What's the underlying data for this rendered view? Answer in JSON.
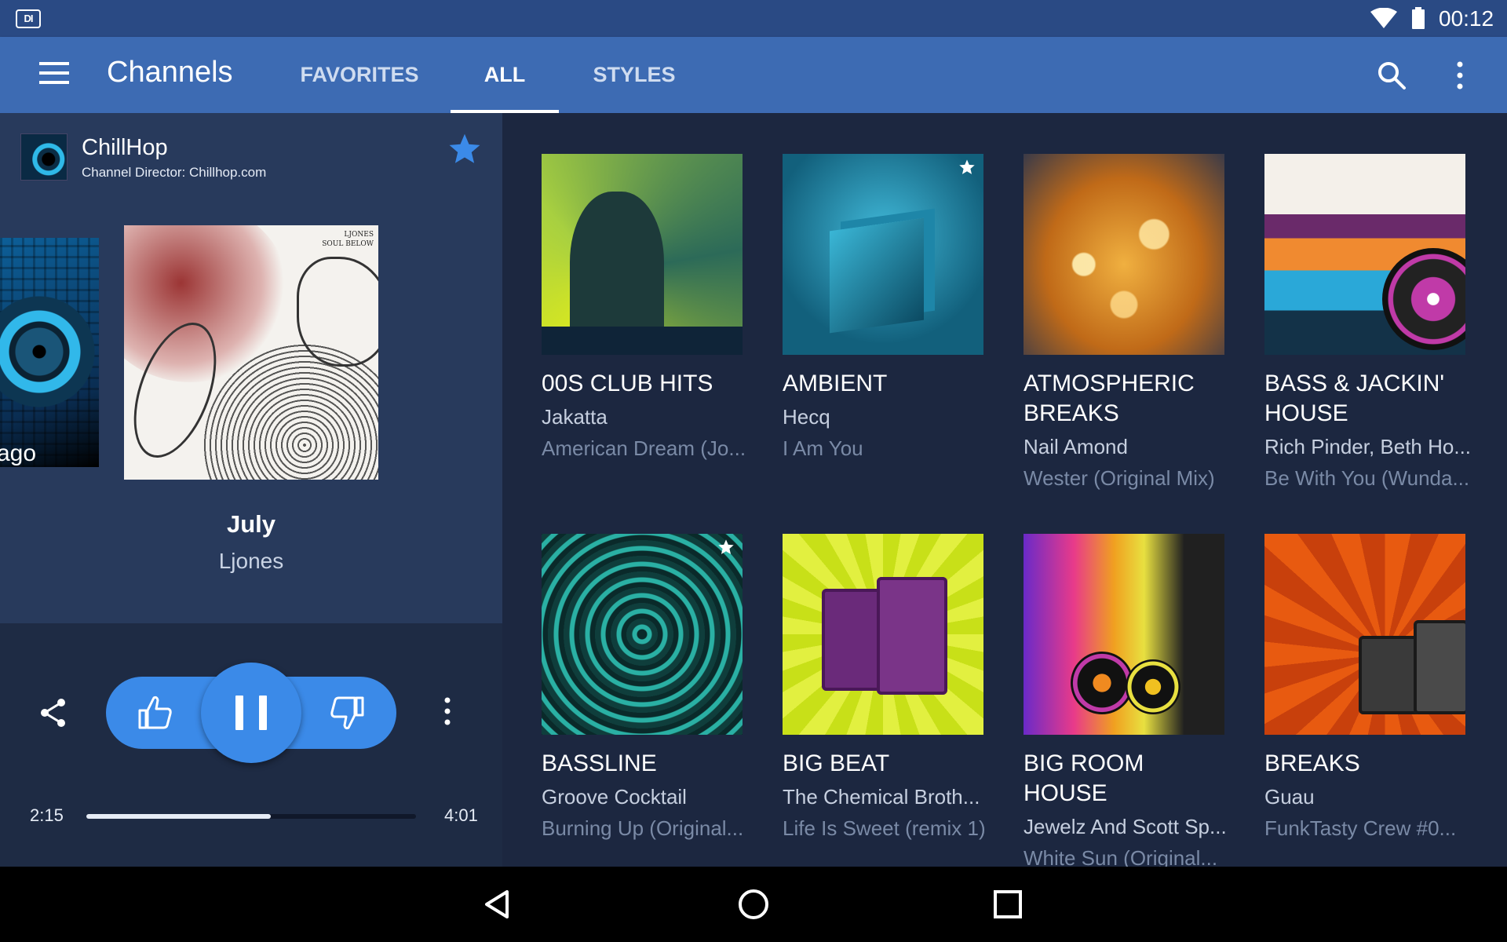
{
  "status_bar": {
    "time": "00:12",
    "app_icon": "DI"
  },
  "app_bar": {
    "title": "Channels",
    "tabs": [
      {
        "label": "FAVORITES",
        "active": false
      },
      {
        "label": "ALL",
        "active": true
      },
      {
        "label": "STYLES",
        "active": false
      }
    ]
  },
  "player": {
    "channel_name": "ChillHop",
    "channel_director": "Channel Director: Chillhop.com",
    "favorited": true,
    "prev_art_label": "ago",
    "current_art_text": "LJONES\nSOUL BELOW",
    "track_title": "July",
    "track_artist": "Ljones",
    "elapsed": "2:15",
    "duration": "4:01",
    "progress_fraction": 0.56
  },
  "channels": [
    {
      "name": "00S CLUB HITS",
      "artist": "Jakatta",
      "song": "American Dream (Jo...",
      "favorite": false
    },
    {
      "name": "AMBIENT",
      "artist": "Hecq",
      "song": "I Am You",
      "favorite": true
    },
    {
      "name": "ATMOSPHERIC BREAKS",
      "artist": "Nail Amond",
      "song": "Wester (Original Mix)",
      "favorite": false
    },
    {
      "name": "BASS & JACKIN' HOUSE",
      "artist": "Rich Pinder, Beth Ho...",
      "song": "Be With You (Wunda...",
      "favorite": false
    },
    {
      "name": "BASSLINE",
      "artist": "Groove Cocktail",
      "song": "Burning Up (Original...",
      "favorite": true
    },
    {
      "name": "BIG BEAT",
      "artist": "The Chemical Broth...",
      "song": "Life Is Sweet (remix 1)",
      "favorite": false
    },
    {
      "name": "BIG ROOM HOUSE",
      "artist": "Jewelz And Scott Sp...",
      "song": "White Sun (Original...",
      "favorite": false
    },
    {
      "name": "BREAKS",
      "artist": "Guau",
      "song": "FunkTasty Crew #0...",
      "favorite": false
    }
  ],
  "colors": {
    "status_bar": "#2a4a84",
    "app_bar": "#3d6bb3",
    "accent": "#3b8ae8",
    "panel": "#283a5c",
    "background": "#1c2740"
  }
}
